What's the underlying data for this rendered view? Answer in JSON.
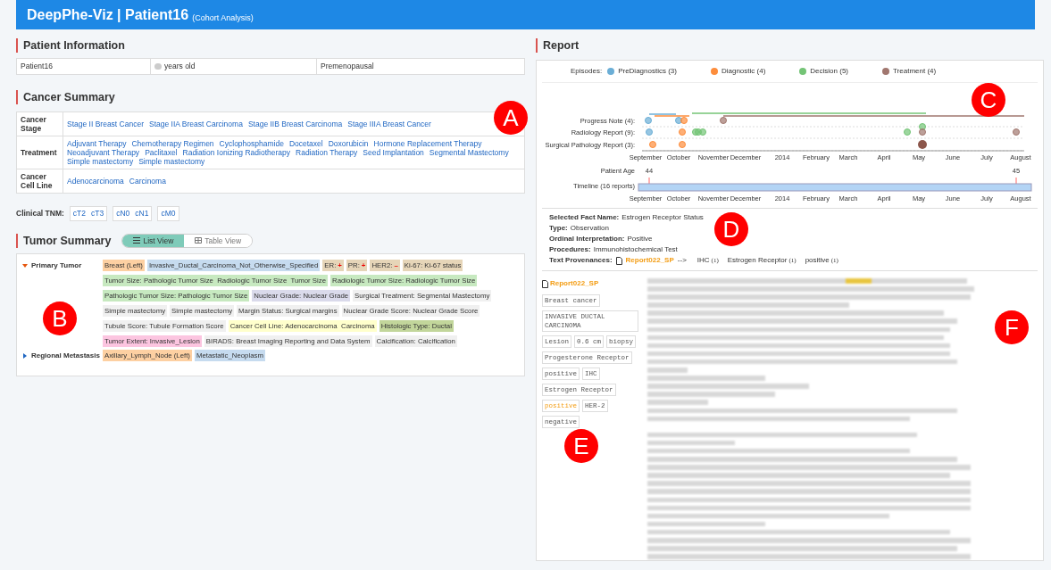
{
  "header": {
    "title": "DeepPhe-Viz | Patient16",
    "subtitle": "(Cohort Analysis)"
  },
  "patient_info": {
    "heading": "Patient Information",
    "name": "Patient16",
    "age_unit": "years old",
    "status": "Premenopausal"
  },
  "cancer_summary": {
    "heading": "Cancer Summary",
    "rows": [
      {
        "label": "Cancer Stage",
        "values": [
          "Stage II Breast Cancer",
          "Stage IIA Breast Carcinoma",
          "Stage IIB Breast Carcinoma",
          "Stage IIIA Breast Cancer"
        ]
      },
      {
        "label": "Treatment",
        "values": [
          "Adjuvant Therapy",
          "Chemotherapy Regimen",
          "Cyclophosphamide",
          "Docetaxel",
          "Doxorubicin",
          "Hormone Replacement Therapy",
          "Neoadjuvant Therapy",
          "Paclitaxel",
          "Radiation Ionizing Radiotherapy",
          "Radiation Therapy",
          "Seed Implantation",
          "Segmental Mastectomy",
          "Simple mastectomy",
          "Simple mastectomy"
        ]
      },
      {
        "label": "Cancer Cell Line",
        "values": [
          "Adenocarcinoma",
          "Carcinoma"
        ]
      }
    ]
  },
  "clinical_tnm": {
    "label": "Clinical TNM:",
    "groups": [
      [
        "cT2",
        "cT3"
      ],
      [
        "cN0",
        "cN1"
      ],
      [
        "cM0"
      ]
    ]
  },
  "tumor_summary": {
    "heading": "Tumor Summary",
    "views": [
      {
        "label": "List View",
        "selected": true
      },
      {
        "label": "Table View",
        "selected": false
      }
    ],
    "tumors": [
      {
        "name": "Primary Tumor",
        "expanded": true,
        "tags": [
          {
            "label": "Breast (Left)",
            "color": "#fdd0a2"
          },
          {
            "label": "Invasive_Ductal_Carcinoma_Not_Otherwise_Specified",
            "color": "#c6dbef"
          },
          {
            "label": "ER:",
            "sign": "+",
            "color": "#e6d5b8"
          },
          {
            "label": "PR:",
            "sign": "+",
            "color": "#e6d5b8"
          },
          {
            "label": "HER2:",
            "sign": "–",
            "color": "#e6d5b8"
          },
          {
            "label": "Ki-67: Ki-67 status",
            "color": "#e6d5b8"
          },
          {
            "label": "Tumor Size: Pathologic Tumor Size  Radiologic Tumor Size  Tumor Size",
            "color": "#c7e9c0"
          },
          {
            "label": "Radiologic Tumor Size: Radiologic Tumor Size",
            "color": "#c7e9c0"
          },
          {
            "label": "Pathologic Tumor Size: Pathologic Tumor Size",
            "color": "#c7e9c0"
          },
          {
            "label": "Nuclear Grade: Nuclear Grade",
            "color": "#dadaeb"
          },
          {
            "label": "Surgical Treatment: Segmental Mastectomy",
            "color": "#f0f0f0"
          },
          {
            "label": "Simple mastectomy",
            "color": "#f0f0f0"
          },
          {
            "label": "Simple mastectomy",
            "color": "#f0f0f0"
          },
          {
            "label": "Margin Status: Surgical margins",
            "color": "#f0f0f0"
          },
          {
            "label": "Nuclear Grade Score: Nuclear Grade Score",
            "color": "#f0f0f0"
          },
          {
            "label": "Tubule Score: Tubule Formation Score",
            "color": "#f0f0f0"
          },
          {
            "label": "Cancer Cell Line: Adenocarcinoma  Carcinoma",
            "color": "#ffffcc"
          },
          {
            "label": "Histologic Type: Ductal",
            "color": "#c2d69b"
          },
          {
            "label": "Tumor Extent: Invasive_Lesion",
            "color": "#fcc5e0"
          },
          {
            "label": "BIRADS: Breast Imaging Reporting and Data System",
            "color": "#f0f0f0"
          },
          {
            "label": "Calcification: Calcification",
            "color": "#f0f0f0"
          }
        ]
      },
      {
        "name": "Regional Metastasis",
        "expanded": false,
        "tags": [
          {
            "label": "Axillary_Lymph_Node (Left)",
            "color": "#fdd0a2"
          },
          {
            "label": "Metastatic_Neoplasm",
            "color": "#c6dbef"
          }
        ]
      }
    ]
  },
  "report": {
    "heading": "Report",
    "episodes_label": "Episodes:",
    "episodes": [
      {
        "label": "PreDiagnostics (3)",
        "color": "#6baed6"
      },
      {
        "label": "Diagnostic (4)",
        "color": "#fd8d3c"
      },
      {
        "label": "Decision (5)",
        "color": "#74c476"
      },
      {
        "label": "Treatment (4)",
        "color": "#a1776f"
      }
    ],
    "rows": [
      "Progress Note (4):",
      "Radiology Report (9):",
      "Surgical Pathology Report (3):"
    ],
    "top_axis": [
      "September",
      "October",
      "November",
      "December",
      "2014",
      "February",
      "March",
      "April",
      "May",
      "June",
      "July",
      "August"
    ],
    "age_label": "Patient Age",
    "ages": [
      "44",
      "45"
    ],
    "timeline_label": "Timeline (16 reports)",
    "bottom_axis": [
      "September",
      "October",
      "November",
      "December",
      "2014",
      "February",
      "March",
      "April",
      "May",
      "June",
      "July",
      "August"
    ],
    "facts": [
      {
        "key": "Selected Fact Name:",
        "value": "Estrogen Receptor Status"
      },
      {
        "key": "Type:",
        "value": "Observation"
      },
      {
        "key": "Ordinal Interpretation:",
        "value": "Positive"
      },
      {
        "key": "Procedures:",
        "value": "Immunohistochemical Test"
      }
    ],
    "provenance": {
      "key": "Text Provenances:",
      "report": "Report022_SP",
      "arrow": "-->",
      "items": [
        {
          "text": "IHC",
          "count": "(1)"
        },
        {
          "text": "Estrogen Receptor",
          "count": "(1)"
        },
        {
          "text": "positive",
          "count": "(1)"
        }
      ]
    },
    "document": {
      "name": "Report022_SP",
      "mentions": [
        [
          {
            "text": "Breast cancer",
            "selected": false
          }
        ],
        [
          {
            "text": "INVASIVE DUCTAL CARCINOMA",
            "selected": false
          }
        ],
        [
          {
            "text": "Lesion",
            "selected": false
          },
          {
            "text": "0.6 cm",
            "selected": false
          },
          {
            "text": "biopsy",
            "selected": false
          }
        ],
        [
          {
            "text": "Progesterone Receptor",
            "selected": false
          }
        ],
        [
          {
            "text": "positive",
            "selected": false
          },
          {
            "text": "IHC",
            "selected": false
          }
        ],
        [
          {
            "text": "Estrogen Receptor",
            "selected": false
          }
        ],
        [
          {
            "text": "positive",
            "selected": true
          },
          {
            "text": "HER-2",
            "selected": false
          }
        ],
        [
          {
            "text": "negative",
            "selected": false
          }
        ]
      ]
    }
  },
  "markers": [
    "A",
    "B",
    "C",
    "D",
    "E",
    "F"
  ]
}
